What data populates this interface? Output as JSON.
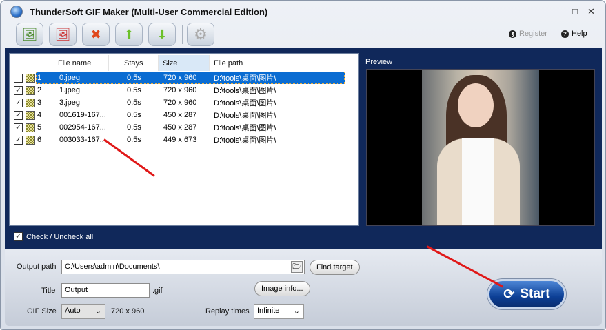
{
  "window": {
    "title": "ThunderSoft GIF Maker (Multi-User Commercial Edition)"
  },
  "toolbar": {
    "buttons": [
      {
        "name": "add-image-icon",
        "glyph": "🖼"
      },
      {
        "name": "remove-image-icon",
        "glyph": "🖼"
      },
      {
        "name": "delete-file-icon",
        "glyph": "✖"
      },
      {
        "name": "move-up-icon",
        "glyph": "⬆"
      },
      {
        "name": "move-down-icon",
        "glyph": "⬇"
      },
      {
        "name": "settings-gear-icon",
        "glyph": "⚙"
      }
    ],
    "register": "Register",
    "help": "Help"
  },
  "list": {
    "headers": [
      "File name",
      "Stays",
      "Size",
      "File path"
    ],
    "rows": [
      {
        "num": "1",
        "name": "0.jpeg",
        "stays": "0.5s",
        "size": "720 x 960",
        "path": "D:\\tools\\桌面\\图片\\",
        "selected": true
      },
      {
        "num": "2",
        "name": "1.jpeg",
        "stays": "0.5s",
        "size": "720 x 960",
        "path": "D:\\tools\\桌面\\图片\\"
      },
      {
        "num": "3",
        "name": "3.jpeg",
        "stays": "0.5s",
        "size": "720 x 960",
        "path": "D:\\tools\\桌面\\图片\\"
      },
      {
        "num": "4",
        "name": "001619-167...",
        "stays": "0.5s",
        "size": "450 x 287",
        "path": "D:\\tools\\桌面\\图片\\"
      },
      {
        "num": "5",
        "name": "002954-167...",
        "stays": "0.5s",
        "size": "450 x 287",
        "path": "D:\\tools\\桌面\\图片\\"
      },
      {
        "num": "6",
        "name": "003033-167...",
        "stays": "0.5s",
        "size": "449 x 673",
        "path": "D:\\tools\\桌面\\图片\\"
      }
    ]
  },
  "preview": {
    "label": "Preview"
  },
  "check_all": "Check / Uncheck all",
  "output": {
    "path_label": "Output path",
    "path": "C:\\Users\\admin\\Documents\\",
    "find_target": "Find target",
    "title_label": "Title",
    "title": "Output",
    "ext": ".gif",
    "image_info": "Image info...",
    "gif_size_label": "GIF Size",
    "gif_size": "Auto",
    "gif_dims": "720 x 960",
    "replay_label": "Replay times",
    "replay": "Infinite"
  },
  "start": "Start"
}
